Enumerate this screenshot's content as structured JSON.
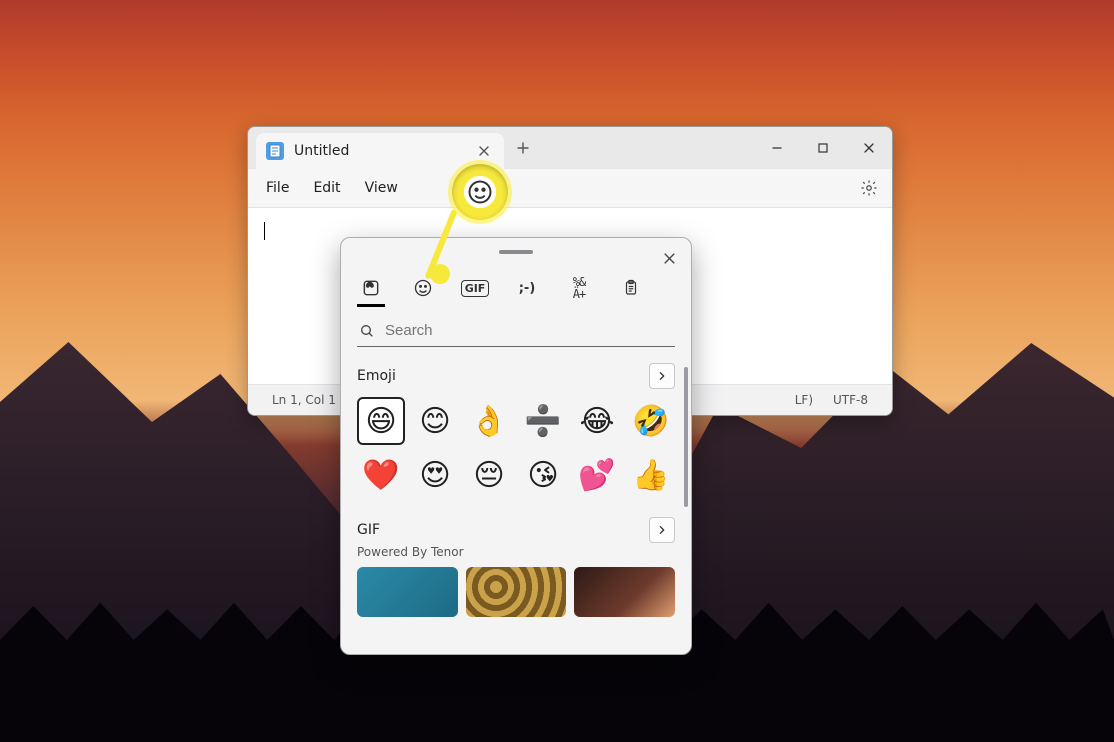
{
  "notepad": {
    "tab_title": "Untitled",
    "menu": {
      "file": "File",
      "edit": "Edit",
      "view": "View"
    },
    "status": {
      "lncol": "Ln 1, Col 1",
      "line_ending": "LF)",
      "encoding": "UTF-8"
    }
  },
  "emoji_panel": {
    "search_placeholder": "Search",
    "cat_tabs": [
      "recent",
      "emoji",
      "gif",
      "kaomoji",
      "symbols",
      "clipboard"
    ],
    "sections": {
      "emoji_heading": "Emoji",
      "gif_heading": "GIF",
      "gif_subtitle": "Powered By Tenor"
    },
    "emoji_grid": [
      [
        "😄",
        "😊",
        "👌",
        "➗",
        "😂",
        "🤣"
      ],
      [
        "❤️",
        "😍",
        "😔",
        "😘",
        "💕",
        "👍"
      ]
    ],
    "kaomoji_label": ";-)",
    "gif_label": "GIF"
  },
  "callout": {
    "icon": "smiley"
  }
}
